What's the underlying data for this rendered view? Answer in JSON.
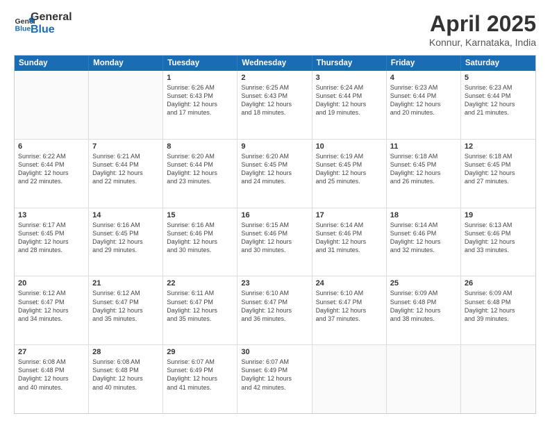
{
  "header": {
    "logo_general": "General",
    "logo_blue": "Blue",
    "month": "April 2025",
    "location": "Konnur, Karnataka, India"
  },
  "weekdays": [
    "Sunday",
    "Monday",
    "Tuesday",
    "Wednesday",
    "Thursday",
    "Friday",
    "Saturday"
  ],
  "weeks": [
    [
      {
        "day": "",
        "sunrise": "",
        "sunset": "",
        "daylight": ""
      },
      {
        "day": "",
        "sunrise": "",
        "sunset": "",
        "daylight": ""
      },
      {
        "day": "1",
        "sunrise": "Sunrise: 6:26 AM",
        "sunset": "Sunset: 6:43 PM",
        "daylight": "Daylight: 12 hours and 17 minutes."
      },
      {
        "day": "2",
        "sunrise": "Sunrise: 6:25 AM",
        "sunset": "Sunset: 6:43 PM",
        "daylight": "Daylight: 12 hours and 18 minutes."
      },
      {
        "day": "3",
        "sunrise": "Sunrise: 6:24 AM",
        "sunset": "Sunset: 6:44 PM",
        "daylight": "Daylight: 12 hours and 19 minutes."
      },
      {
        "day": "4",
        "sunrise": "Sunrise: 6:23 AM",
        "sunset": "Sunset: 6:44 PM",
        "daylight": "Daylight: 12 hours and 20 minutes."
      },
      {
        "day": "5",
        "sunrise": "Sunrise: 6:23 AM",
        "sunset": "Sunset: 6:44 PM",
        "daylight": "Daylight: 12 hours and 21 minutes."
      }
    ],
    [
      {
        "day": "6",
        "sunrise": "Sunrise: 6:22 AM",
        "sunset": "Sunset: 6:44 PM",
        "daylight": "Daylight: 12 hours and 22 minutes."
      },
      {
        "day": "7",
        "sunrise": "Sunrise: 6:21 AM",
        "sunset": "Sunset: 6:44 PM",
        "daylight": "Daylight: 12 hours and 22 minutes."
      },
      {
        "day": "8",
        "sunrise": "Sunrise: 6:20 AM",
        "sunset": "Sunset: 6:44 PM",
        "daylight": "Daylight: 12 hours and 23 minutes."
      },
      {
        "day": "9",
        "sunrise": "Sunrise: 6:20 AM",
        "sunset": "Sunset: 6:45 PM",
        "daylight": "Daylight: 12 hours and 24 minutes."
      },
      {
        "day": "10",
        "sunrise": "Sunrise: 6:19 AM",
        "sunset": "Sunset: 6:45 PM",
        "daylight": "Daylight: 12 hours and 25 minutes."
      },
      {
        "day": "11",
        "sunrise": "Sunrise: 6:18 AM",
        "sunset": "Sunset: 6:45 PM",
        "daylight": "Daylight: 12 hours and 26 minutes."
      },
      {
        "day": "12",
        "sunrise": "Sunrise: 6:18 AM",
        "sunset": "Sunset: 6:45 PM",
        "daylight": "Daylight: 12 hours and 27 minutes."
      }
    ],
    [
      {
        "day": "13",
        "sunrise": "Sunrise: 6:17 AM",
        "sunset": "Sunset: 6:45 PM",
        "daylight": "Daylight: 12 hours and 28 minutes."
      },
      {
        "day": "14",
        "sunrise": "Sunrise: 6:16 AM",
        "sunset": "Sunset: 6:45 PM",
        "daylight": "Daylight: 12 hours and 29 minutes."
      },
      {
        "day": "15",
        "sunrise": "Sunrise: 6:16 AM",
        "sunset": "Sunset: 6:46 PM",
        "daylight": "Daylight: 12 hours and 30 minutes."
      },
      {
        "day": "16",
        "sunrise": "Sunrise: 6:15 AM",
        "sunset": "Sunset: 6:46 PM",
        "daylight": "Daylight: 12 hours and 30 minutes."
      },
      {
        "day": "17",
        "sunrise": "Sunrise: 6:14 AM",
        "sunset": "Sunset: 6:46 PM",
        "daylight": "Daylight: 12 hours and 31 minutes."
      },
      {
        "day": "18",
        "sunrise": "Sunrise: 6:14 AM",
        "sunset": "Sunset: 6:46 PM",
        "daylight": "Daylight: 12 hours and 32 minutes."
      },
      {
        "day": "19",
        "sunrise": "Sunrise: 6:13 AM",
        "sunset": "Sunset: 6:46 PM",
        "daylight": "Daylight: 12 hours and 33 minutes."
      }
    ],
    [
      {
        "day": "20",
        "sunrise": "Sunrise: 6:12 AM",
        "sunset": "Sunset: 6:47 PM",
        "daylight": "Daylight: 12 hours and 34 minutes."
      },
      {
        "day": "21",
        "sunrise": "Sunrise: 6:12 AM",
        "sunset": "Sunset: 6:47 PM",
        "daylight": "Daylight: 12 hours and 35 minutes."
      },
      {
        "day": "22",
        "sunrise": "Sunrise: 6:11 AM",
        "sunset": "Sunset: 6:47 PM",
        "daylight": "Daylight: 12 hours and 35 minutes."
      },
      {
        "day": "23",
        "sunrise": "Sunrise: 6:10 AM",
        "sunset": "Sunset: 6:47 PM",
        "daylight": "Daylight: 12 hours and 36 minutes."
      },
      {
        "day": "24",
        "sunrise": "Sunrise: 6:10 AM",
        "sunset": "Sunset: 6:47 PM",
        "daylight": "Daylight: 12 hours and 37 minutes."
      },
      {
        "day": "25",
        "sunrise": "Sunrise: 6:09 AM",
        "sunset": "Sunset: 6:48 PM",
        "daylight": "Daylight: 12 hours and 38 minutes."
      },
      {
        "day": "26",
        "sunrise": "Sunrise: 6:09 AM",
        "sunset": "Sunset: 6:48 PM",
        "daylight": "Daylight: 12 hours and 39 minutes."
      }
    ],
    [
      {
        "day": "27",
        "sunrise": "Sunrise: 6:08 AM",
        "sunset": "Sunset: 6:48 PM",
        "daylight": "Daylight: 12 hours and 40 minutes."
      },
      {
        "day": "28",
        "sunrise": "Sunrise: 6:08 AM",
        "sunset": "Sunset: 6:48 PM",
        "daylight": "Daylight: 12 hours and 40 minutes."
      },
      {
        "day": "29",
        "sunrise": "Sunrise: 6:07 AM",
        "sunset": "Sunset: 6:49 PM",
        "daylight": "Daylight: 12 hours and 41 minutes."
      },
      {
        "day": "30",
        "sunrise": "Sunrise: 6:07 AM",
        "sunset": "Sunset: 6:49 PM",
        "daylight": "Daylight: 12 hours and 42 minutes."
      },
      {
        "day": "",
        "sunrise": "",
        "sunset": "",
        "daylight": ""
      },
      {
        "day": "",
        "sunrise": "",
        "sunset": "",
        "daylight": ""
      },
      {
        "day": "",
        "sunrise": "",
        "sunset": "",
        "daylight": ""
      }
    ]
  ]
}
